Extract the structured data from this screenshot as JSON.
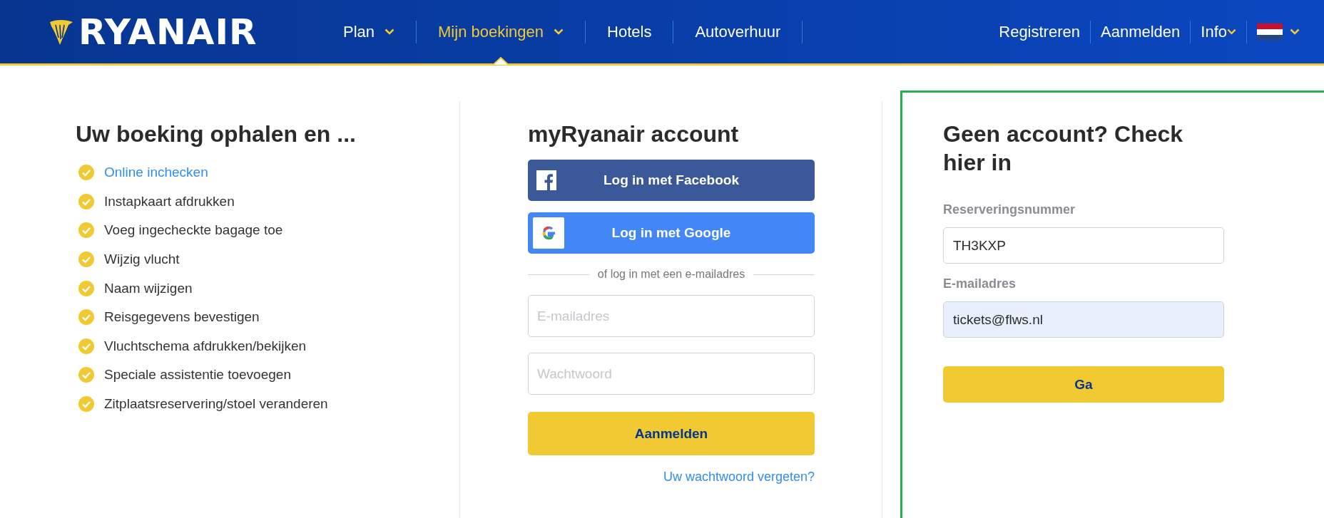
{
  "header": {
    "logo_text": "RYANAIR",
    "nav": [
      {
        "label": "Plan",
        "selected": false,
        "dropdown": true
      },
      {
        "label": "Mijn boekingen",
        "selected": true,
        "dropdown": true
      },
      {
        "label": "Hotels",
        "selected": false,
        "dropdown": false
      },
      {
        "label": "Autoverhuur",
        "selected": false,
        "dropdown": false
      }
    ],
    "account_nav": [
      {
        "label": "Registreren",
        "dropdown": false
      },
      {
        "label": "Aanmelden",
        "dropdown": false
      },
      {
        "label": "Info",
        "dropdown": true
      }
    ]
  },
  "retrieve": {
    "title": "Uw boeking ophalen en ...",
    "items": [
      {
        "text": "Online inchecken",
        "kind": "link"
      },
      {
        "text": "Instapkaart afdrukken",
        "kind": "text"
      },
      {
        "text": "Voeg ingecheckte bagage toe",
        "kind": "text"
      },
      {
        "text": "Wijzig vlucht",
        "kind": "text"
      },
      {
        "text": "Naam wijzigen",
        "kind": "text"
      },
      {
        "text": "Reisgegevens bevestigen",
        "kind": "text"
      },
      {
        "text": "Vluchtschema afdrukken/bekijken",
        "kind": "text"
      },
      {
        "text": "Speciale assistentie toevoegen",
        "kind": "text"
      },
      {
        "text": "Zitplaatsreservering/stoel veranderen",
        "kind": "text"
      }
    ]
  },
  "account": {
    "title": "myRyanair account",
    "social": [
      {
        "label": "Log in met Facebook",
        "kind": "facebook"
      },
      {
        "label": "Log in met Google",
        "kind": "google"
      }
    ],
    "divider": "of log in met een e-mailadres",
    "email": {
      "placeholder": "E-mailadres"
    },
    "password": {
      "placeholder": "Wachtwoord"
    },
    "submit": "Aanmelden",
    "forgot": "Uw wachtwoord vergeten?"
  },
  "checkin": {
    "title": "Geen account? Check hier in",
    "fields": [
      {
        "label": "Reserveringsnummer",
        "value": "TH3KXP",
        "autofilled": false
      },
      {
        "label": "E-mailadres",
        "value": "tickets@flws.nl",
        "autofilled": true
      }
    ],
    "submit": "Ga"
  }
}
